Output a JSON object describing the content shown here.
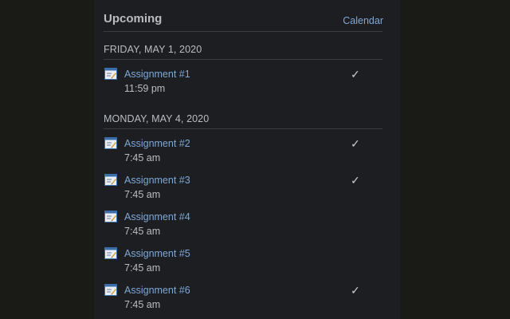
{
  "header": {
    "title": "Upcoming",
    "calendar_link": "Calendar"
  },
  "groups": [
    {
      "date": "FRIDAY, MAY 1, 2020",
      "items": [
        {
          "title": "Assignment #1",
          "time": "11:59 pm",
          "done": true,
          "icon": "assignment-icon"
        }
      ]
    },
    {
      "date": "MONDAY, MAY 4, 2020",
      "items": [
        {
          "title": "Assignment #2",
          "time": "7:45 am",
          "done": true,
          "icon": "assignment-icon"
        },
        {
          "title": "Assignment #3",
          "time": "7:45 am",
          "done": true,
          "icon": "assignment-icon"
        },
        {
          "title": "Assignment #4",
          "time": "7:45 am",
          "done": false,
          "icon": "assignment-icon"
        },
        {
          "title": "Assignment #5",
          "time": "7:45 am",
          "done": false,
          "icon": "assignment-icon"
        },
        {
          "title": "Assignment #6",
          "time": "7:45 am",
          "done": true,
          "icon": "assignment-icon"
        }
      ]
    }
  ],
  "check_glyph": "✓",
  "colors": {
    "background": "#1a1b16",
    "panel": "#1c1e22",
    "link": "#7fa8d6",
    "text": "#b9bcc1",
    "divider": "#3a3d42"
  }
}
